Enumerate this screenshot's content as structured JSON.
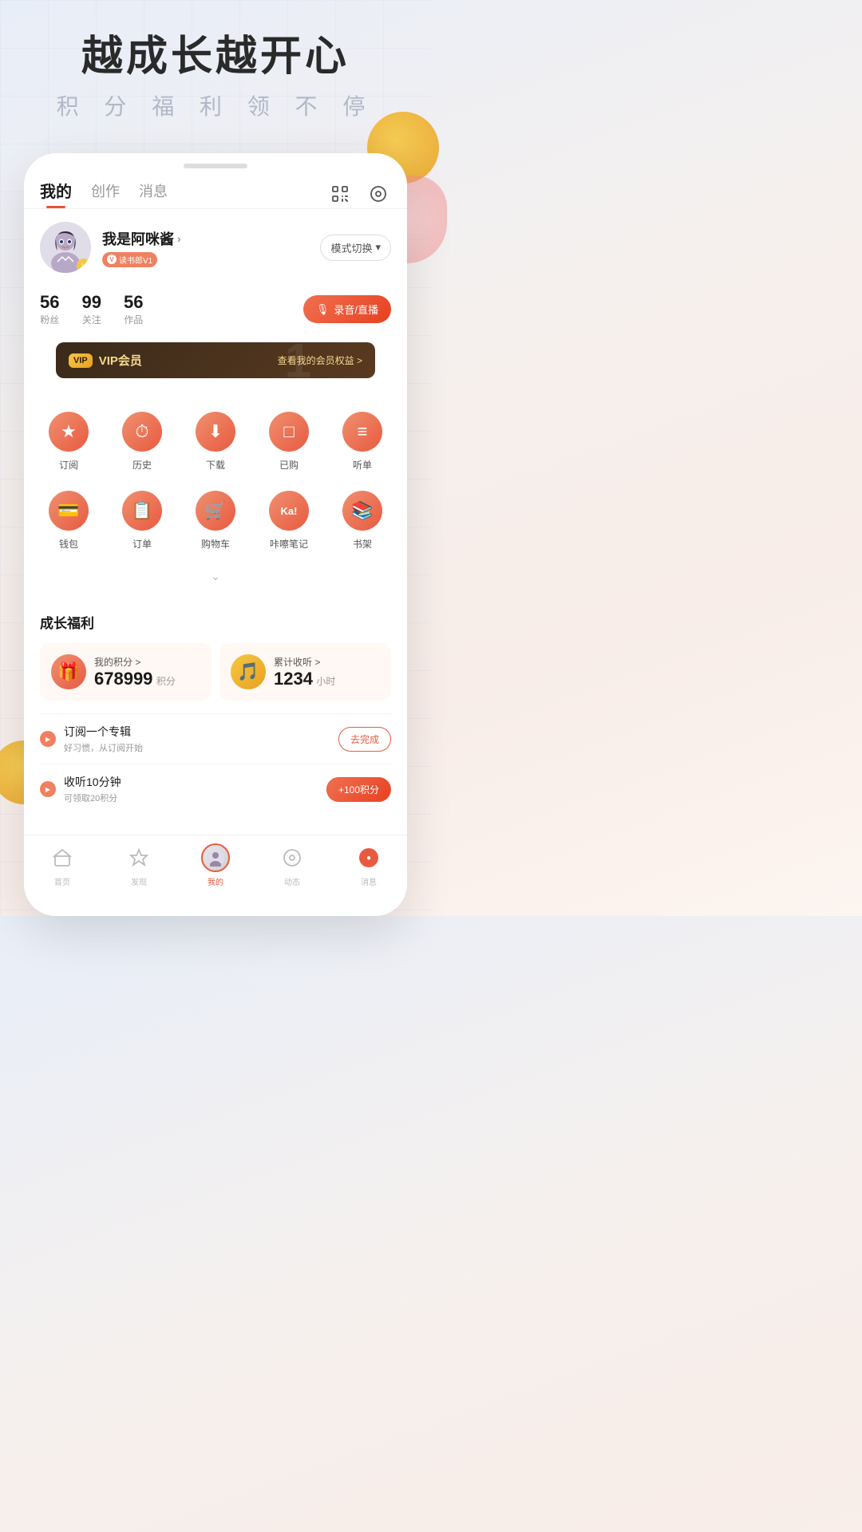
{
  "app": {
    "title": "越成长越开心",
    "subtitle": "积 分 福 利 领 不 停"
  },
  "tabs": {
    "items": [
      {
        "label": "我的",
        "active": true
      },
      {
        "label": "创作",
        "active": false
      },
      {
        "label": "消息",
        "active": false
      }
    ],
    "scan_icon": "⊡",
    "settings_icon": "◎"
  },
  "profile": {
    "name": "我是阿咪酱",
    "badge": "读书郎V1",
    "mode_switch": "模式切换",
    "fans_count": "56",
    "fans_label": "粉丝",
    "follow_count": "99",
    "follow_label": "关注",
    "works_count": "56",
    "works_label": "作品",
    "record_btn": "录音/直播"
  },
  "vip": {
    "badge": "VIP",
    "text": "VIP会员",
    "link": "查看我的会员权益 >"
  },
  "quick_actions_1": [
    {
      "label": "订阅",
      "icon": "★"
    },
    {
      "label": "历史",
      "icon": "⏱"
    },
    {
      "label": "下载",
      "icon": "⬇"
    },
    {
      "label": "已购",
      "icon": "🛒"
    },
    {
      "label": "听单",
      "icon": "☰"
    }
  ],
  "quick_actions_2": [
    {
      "label": "钱包",
      "icon": "💳"
    },
    {
      "label": "订单",
      "icon": "📋"
    },
    {
      "label": "购物车",
      "icon": "🛒"
    },
    {
      "label": "咔嚓笔记",
      "icon": "Ka!"
    },
    {
      "label": "书架",
      "icon": "📚"
    }
  ],
  "growth": {
    "section_title": "成长福利",
    "points_label": "我的积分 >",
    "points_value": "678999",
    "points_unit": "积分",
    "listen_label": "累计收听 >",
    "listen_value": "1234",
    "listen_unit": "小时"
  },
  "tasks": [
    {
      "title": "订阅一个专辑",
      "desc": "好习惯，从订阅开始",
      "btn_label": "去完成",
      "btn_type": "outline"
    },
    {
      "title": "收听10分钟",
      "desc": "可领取20积分",
      "btn_label": "+100积分",
      "btn_type": "filled"
    }
  ],
  "bottom_nav": [
    {
      "label": "首页",
      "icon": "⊡",
      "active": false
    },
    {
      "label": "发现",
      "icon": "☆",
      "active": false
    },
    {
      "label": "我的",
      "icon": "avatar",
      "active": true
    },
    {
      "label": "动态",
      "icon": "◎",
      "active": false
    },
    {
      "label": "消息",
      "icon": "🔴",
      "active": false
    }
  ]
}
